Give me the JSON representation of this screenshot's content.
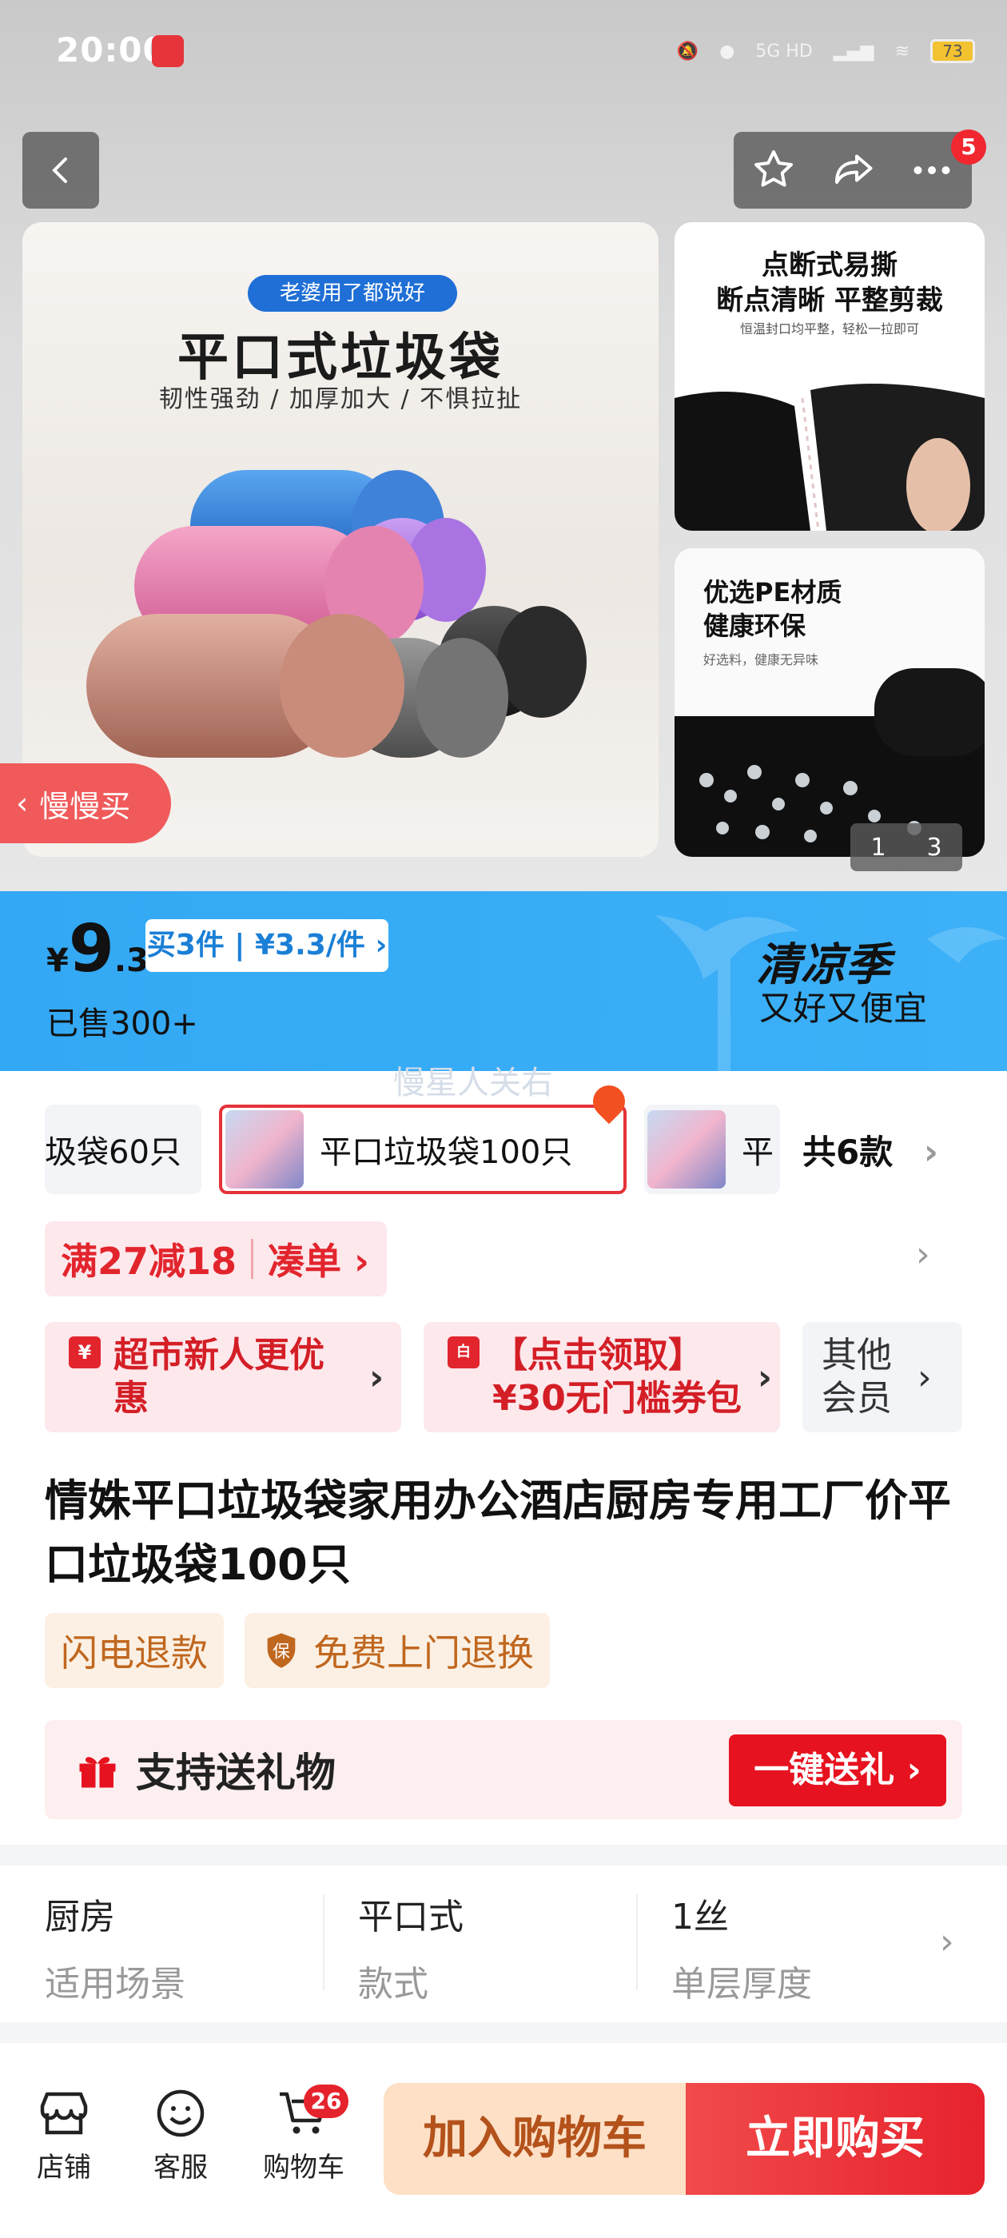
{
  "status_bar": {
    "time": "20:00",
    "battery": "73",
    "network": "5G HD"
  },
  "header": {
    "notification_count": "5"
  },
  "gallery": {
    "main": {
      "pill": "老婆用了都说好",
      "title": "平口式垃圾袋",
      "subtitle": "韧性强劲 / 加厚加大 / 不惧拉扯"
    },
    "side1": {
      "title1": "点断式易撕",
      "title2": "断点清晰 平整剪裁",
      "sub": "恒温封口均平整，轻松一拉即可"
    },
    "side2": {
      "title1": "优选PE材质",
      "title2": "健康环保",
      "sub": "好选料，健康无异味"
    },
    "pager_current": "1",
    "pager_total": "3",
    "slow_buy": "慢慢买"
  },
  "price": {
    "currency": "¥",
    "integer": "9",
    "decimal": ".3",
    "bundle": "买3件 | ¥3.3/件 ›",
    "sold": "已售300+",
    "promo_title": "清凉季",
    "promo_sub": "又好又便宜",
    "watermark": "慢星人关右"
  },
  "variants": {
    "items": [
      {
        "label": "圾袋60只"
      },
      {
        "label": "平口垃圾袋100只"
      },
      {
        "label": "平"
      }
    ],
    "total": "共6款"
  },
  "coupons": {
    "threshold": "满27减18",
    "threshold_action": "凑单 ›",
    "newcomer": "超市新人更优惠",
    "voucher_line1": "【点击领取】",
    "voucher_line2": "¥30无门槛券包",
    "member": "其他会员"
  },
  "product": {
    "title": "情姝平口垃圾袋家用办公酒店厨房专用工厂价平口垃圾袋100只",
    "tags": [
      "闪电退款",
      "免费上门退换"
    ],
    "gift_label": "支持送礼物",
    "gift_button": "一键送礼 ›"
  },
  "attributes": [
    {
      "value": "厨房",
      "label": "适用场景"
    },
    {
      "value": "平口式",
      "label": "款式"
    },
    {
      "value": "1丝",
      "label": "单层厚度"
    }
  ],
  "bottom": {
    "shop": "店铺",
    "service": "客服",
    "cart": "购物车",
    "cart_count": "26",
    "add_to_cart": "加入购物车",
    "buy_now": "立即购买"
  },
  "colors": {
    "accent": "#e7232d",
    "price_bar": "#36abf6"
  }
}
